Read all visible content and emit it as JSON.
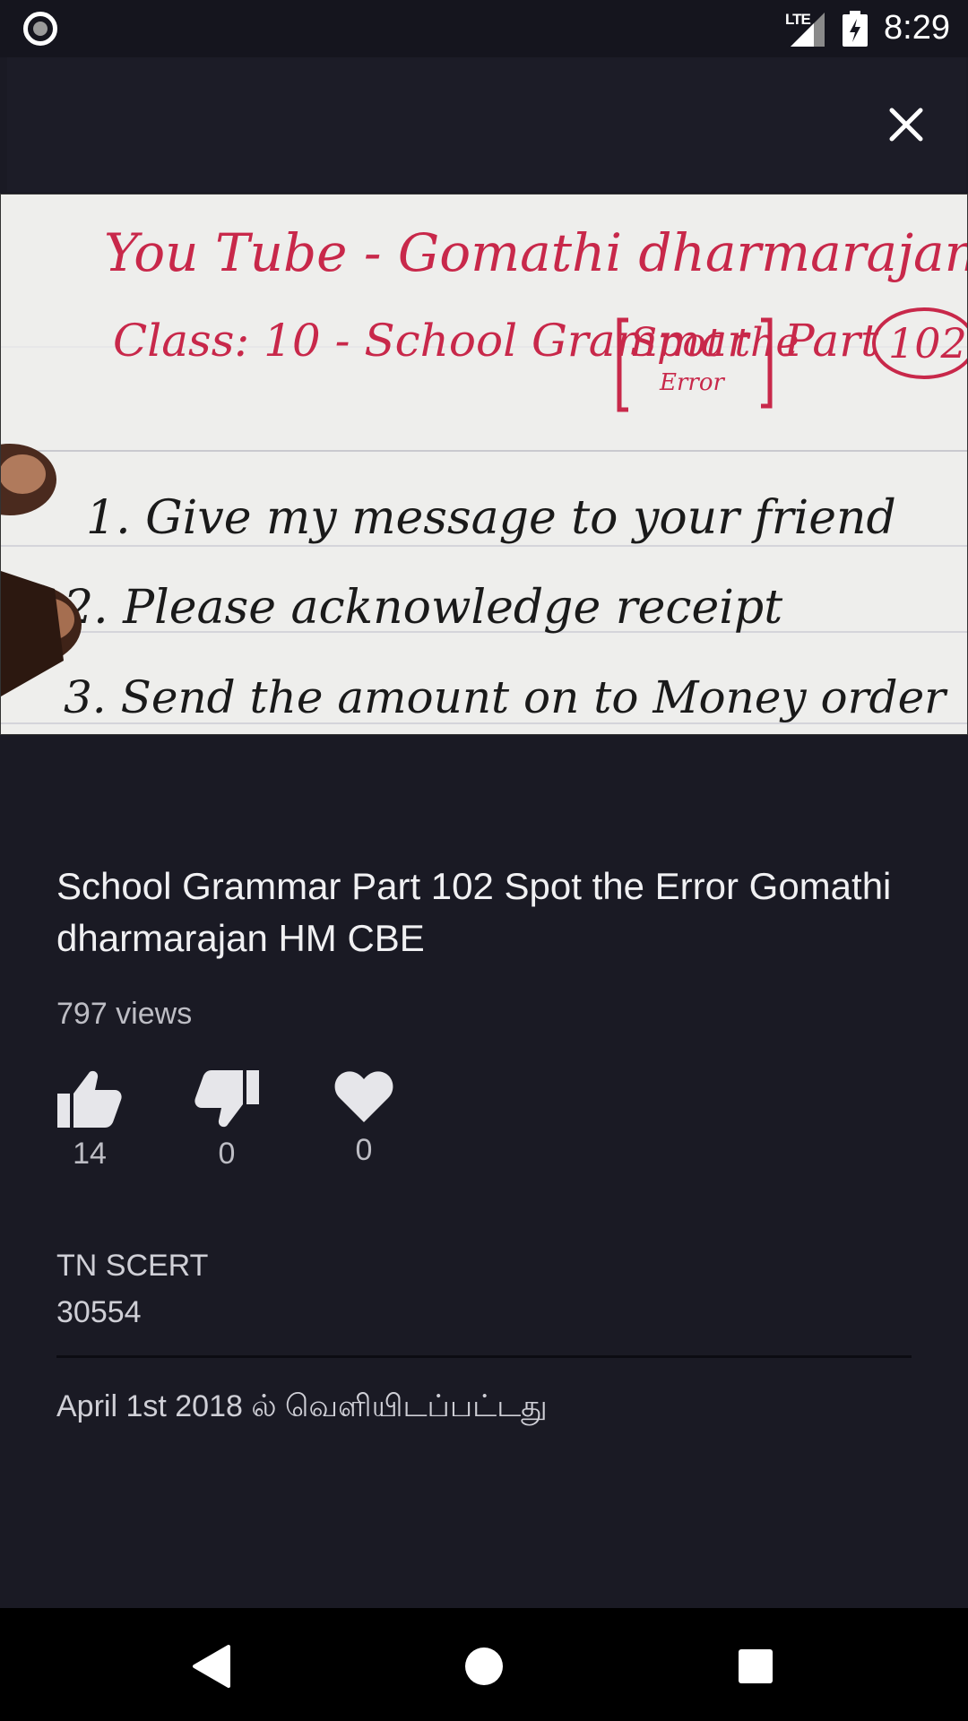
{
  "status_bar": {
    "network": "LTE",
    "time": "8:29"
  },
  "video": {
    "title": "School Grammar Part 102 Spot the Error Gomathi dharmarajan HM CBE",
    "views": "797 views",
    "thumbnail_text": {
      "line1": "You Tube - Gomathi dharmarajan",
      "line2_a": "Class: 10 - School Grammar",
      "line2_box": "Spot the",
      "line2_box_sub": "Error",
      "line2_b": "Part",
      "line2_num": "102",
      "item1": "1.  Give my message to your friend",
      "item2": "2.  Please acknowledge receipt",
      "item3": "3.  Send the amount on to Money order"
    }
  },
  "actions": {
    "likes": "14",
    "dislikes": "0",
    "favorites": "0"
  },
  "channel": {
    "name": "TN SCERT",
    "id": "30554"
  },
  "published": "April 1st 2018 ல் வெளியிடப்பட்டது",
  "colors": {
    "background": "#1a1a24",
    "ink_red": "#c8284a",
    "ink_black": "#1a1a1a"
  },
  "icons": {
    "close": "close-icon",
    "like": "thumb-up-icon",
    "dislike": "thumb-down-icon",
    "favorite": "heart-icon",
    "nav_back": "back-triangle-icon",
    "nav_home": "home-circle-icon",
    "nav_recents": "recents-square-icon"
  }
}
